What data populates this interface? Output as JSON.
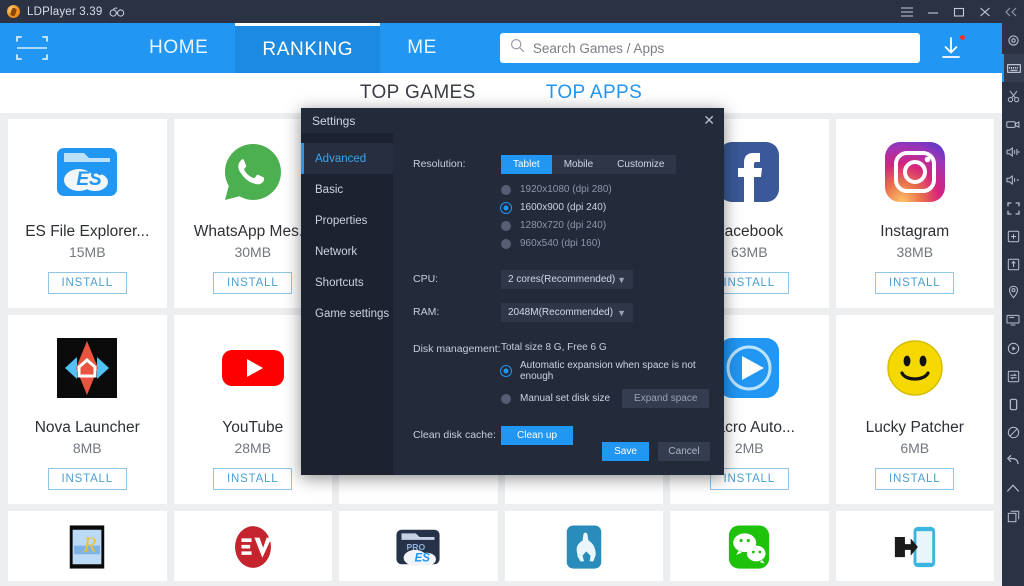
{
  "titlebar": {
    "app_name": "LDPlayer 3.39",
    "logo_icon": "ldplayer-logo-icon",
    "version_badge_icon": "glasses-icon",
    "controls": [
      {
        "name": "menu-button",
        "icon": "hamburger-icon"
      },
      {
        "name": "minimize-button",
        "icon": "minimize-icon"
      },
      {
        "name": "maximize-button",
        "icon": "maximize-icon"
      },
      {
        "name": "close-button",
        "icon": "close-icon"
      },
      {
        "name": "collapse-rail-button",
        "icon": "double-chevron-left-icon"
      }
    ]
  },
  "navbar": {
    "scan_icon": "scan-frame-icon",
    "tabs": [
      {
        "label": "HOME",
        "active": false
      },
      {
        "label": "RANKING",
        "active": true
      },
      {
        "label": "ME",
        "active": false
      }
    ],
    "search": {
      "placeholder": "Search Games / Apps",
      "value": "",
      "icon": "search-icon"
    },
    "download_icon": "download-icon",
    "download_badge": true
  },
  "rail": {
    "items": [
      {
        "name": "rail-settings",
        "icon": "gear-icon"
      },
      {
        "name": "rail-keyboard",
        "icon": "keyboard-icon",
        "selected": true
      },
      {
        "name": "rail-scissors",
        "icon": "scissors-icon"
      },
      {
        "name": "rail-record",
        "icon": "video-camera-icon"
      },
      {
        "name": "rail-volume-up",
        "icon": "volume-up-icon"
      },
      {
        "name": "rail-volume-down",
        "icon": "volume-down-icon"
      },
      {
        "name": "rail-fullscreen",
        "icon": "fullscreen-icon"
      },
      {
        "name": "rail-add-instance",
        "icon": "add-box-icon"
      },
      {
        "name": "rail-apk-install",
        "icon": "apk-install-icon"
      },
      {
        "name": "rail-location",
        "icon": "location-pin-icon"
      },
      {
        "name": "rail-multi-window",
        "icon": "monitor-icon"
      },
      {
        "name": "rail-operation-record",
        "icon": "play-circle-icon"
      },
      {
        "name": "rail-sync",
        "icon": "sync-arrows-icon"
      },
      {
        "name": "rail-rotate",
        "icon": "rotate-screen-icon"
      },
      {
        "name": "rail-shake",
        "icon": "no-entry-icon"
      },
      {
        "name": "rail-back",
        "icon": "back-arrow-icon"
      },
      {
        "name": "rail-home",
        "icon": "home-icon"
      },
      {
        "name": "rail-recents",
        "icon": "recents-icon"
      }
    ]
  },
  "content": {
    "category_tabs": [
      {
        "label": "TOP GAMES",
        "active": false
      },
      {
        "label": "TOP APPS",
        "active": true
      }
    ],
    "install_label": "INSTALL",
    "apps": [
      {
        "name": "ES File Explorer...",
        "size": "15MB",
        "icon": "es-file-explorer-icon"
      },
      {
        "name": "WhatsApp Mes...",
        "size": "30MB",
        "icon": "whatsapp-icon"
      },
      {
        "name": "",
        "size": "",
        "icon": "app-icon"
      },
      {
        "name": "",
        "size": "",
        "icon": "app-icon"
      },
      {
        "name": "Facebook",
        "size": "63MB",
        "icon": "facebook-icon"
      },
      {
        "name": "Instagram",
        "size": "38MB",
        "icon": "instagram-icon"
      },
      {
        "name": "Nova Launcher",
        "size": "8MB",
        "icon": "nova-launcher-icon"
      },
      {
        "name": "YouTube",
        "size": "28MB",
        "icon": "youtube-icon"
      },
      {
        "name": "",
        "size": "",
        "icon": "app-icon"
      },
      {
        "name": "",
        "size": "",
        "icon": "app-icon"
      },
      {
        "name": "Macro Auto...",
        "size": "2MB",
        "icon": "macro-auto-clicker-icon"
      },
      {
        "name": "Lucky Patcher",
        "size": "6MB",
        "icon": "lucky-patcher-icon"
      }
    ],
    "apps_partial_row": [
      {
        "icon": "root-explorer-icon"
      },
      {
        "icon": "expressvpn-icon"
      },
      {
        "icon": "es-file-explorer-pro-icon"
      },
      {
        "icon": "llama-icon"
      },
      {
        "icon": "wechat-icon"
      },
      {
        "icon": "xmodgames-icon"
      }
    ]
  },
  "dialog": {
    "title": "Settings",
    "close_icon": "close-icon",
    "nav": [
      {
        "label": "Advanced",
        "active": true
      },
      {
        "label": "Basic",
        "active": false
      },
      {
        "label": "Properties",
        "active": false
      },
      {
        "label": "Network",
        "active": false
      },
      {
        "label": "Shortcuts",
        "active": false
      },
      {
        "label": "Game settings",
        "active": false
      }
    ],
    "resolution": {
      "label": "Resolution:",
      "modes": [
        {
          "label": "Tablet",
          "active": true
        },
        {
          "label": "Mobile",
          "active": false
        },
        {
          "label": "Customize",
          "active": false
        }
      ],
      "options": [
        {
          "label": "1920x1080  (dpi 280)",
          "selected": false
        },
        {
          "label": "1600x900  (dpi 240)",
          "selected": true
        },
        {
          "label": "1280x720  (dpi 240)",
          "selected": false
        },
        {
          "label": "960x540  (dpi 160)",
          "selected": false
        }
      ]
    },
    "cpu": {
      "label": "CPU:",
      "value": "2 cores(Recommended)",
      "chevron_icon": "chevron-down-icon"
    },
    "ram": {
      "label": "RAM:",
      "value": "2048M(Recommended)",
      "chevron_icon": "chevron-down-icon"
    },
    "disk": {
      "label": "Disk management:",
      "summary": "Total size 8 G,  Free 6 G",
      "options": [
        {
          "label": "Automatic expansion when space is not enough",
          "selected": true
        },
        {
          "label": "Manual set disk size",
          "selected": false
        }
      ],
      "expand_button": "Expand space"
    },
    "clean": {
      "label": "Clean disk cache:",
      "button": "Clean up"
    },
    "save_label": "Save",
    "cancel_label": "Cancel"
  },
  "colors": {
    "accent": "#2196f3",
    "navbar": "#2196f3",
    "titlebar": "#2b3243",
    "dialog_bg": "#232a3a",
    "dialog_side": "#1c2230",
    "install_border": "#8fc6e8"
  }
}
